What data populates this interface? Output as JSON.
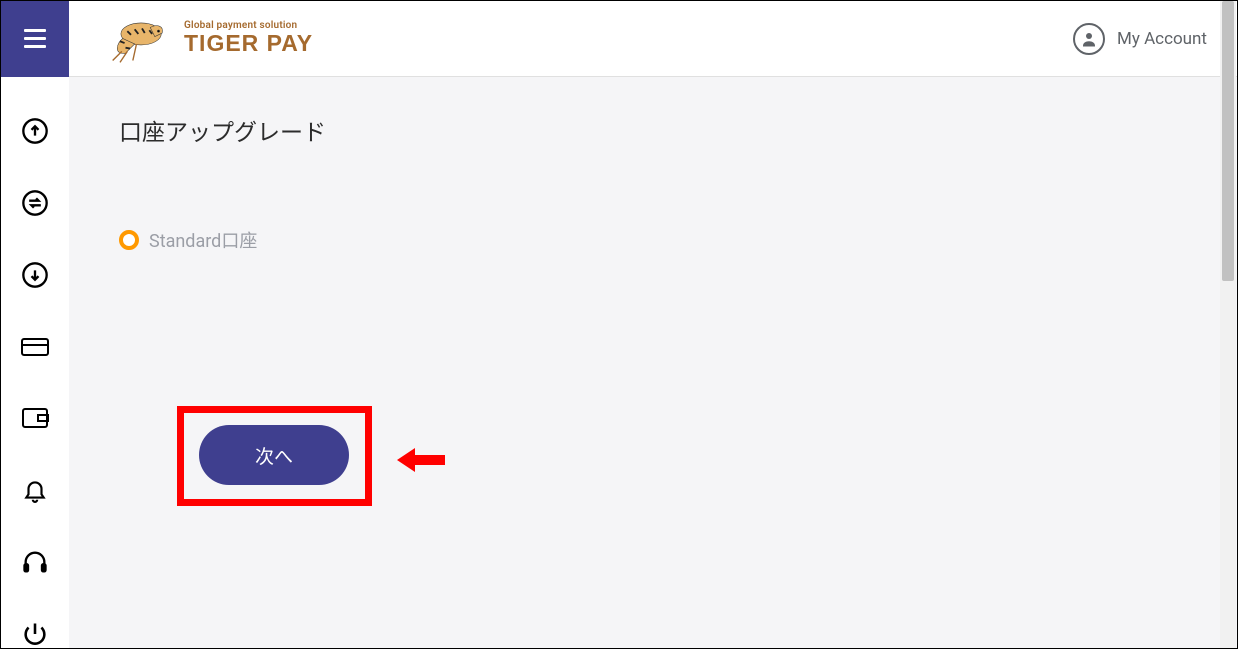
{
  "header": {
    "logo_tagline": "Global payment solution",
    "logo_brand": "TIGER PAY",
    "account_label": "My Account"
  },
  "sidebar": {
    "items": [
      {
        "name": "upload-icon"
      },
      {
        "name": "exchange-icon"
      },
      {
        "name": "download-icon"
      },
      {
        "name": "card-icon"
      },
      {
        "name": "wallet-icon"
      },
      {
        "name": "bell-icon"
      },
      {
        "name": "headset-icon"
      },
      {
        "name": "power-icon"
      }
    ]
  },
  "main": {
    "page_title": "口座アップグレード",
    "option_label": "Standard口座",
    "next_button_label": "次へ"
  },
  "colors": {
    "primary": "#3f3f8f",
    "accent": "#ff9900",
    "highlight": "#ff0000"
  }
}
